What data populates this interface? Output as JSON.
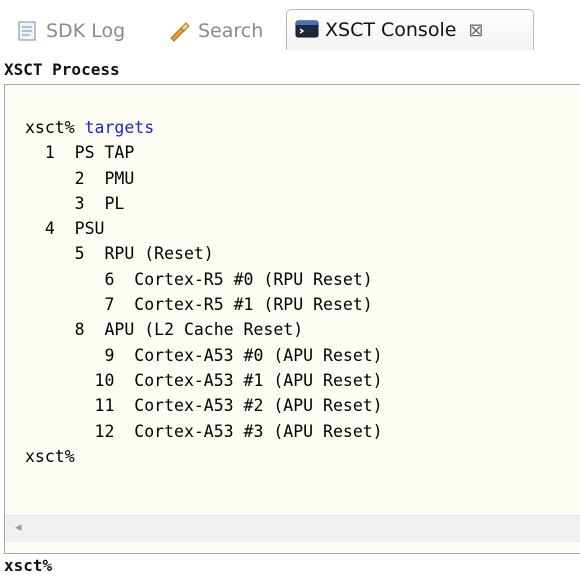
{
  "tabs": [
    {
      "label": "SDK Log",
      "icon": "log-icon"
    },
    {
      "label": "Search",
      "icon": "search-flashlight-icon"
    },
    {
      "label": "XSCT Console",
      "icon": "console-icon",
      "active": true,
      "close": "⊠"
    }
  ],
  "console": {
    "title": "XSCT Process",
    "prompt_prefix": "xsct%",
    "command": "targets",
    "lines": [
      "  1  PS TAP",
      "     2  PMU",
      "     3  PL",
      "  4  PSU",
      "     5  RPU (Reset)",
      "        6  Cortex-R5 #0 (RPU Reset)",
      "        7  Cortex-R5 #1 (RPU Reset)",
      "     8  APU (L2 Cache Reset)",
      "        9  Cortex-A53 #0 (APU Reset)",
      "       10  Cortex-A53 #1 (APU Reset)",
      "       11  Cortex-A53 #2 (APU Reset)",
      "       12  Cortex-A53 #3 (APU Reset)"
    ],
    "end_prompt": "xsct%"
  },
  "scrollbar": {
    "left_arrow": "◂"
  },
  "input_prompt": "xsct%"
}
